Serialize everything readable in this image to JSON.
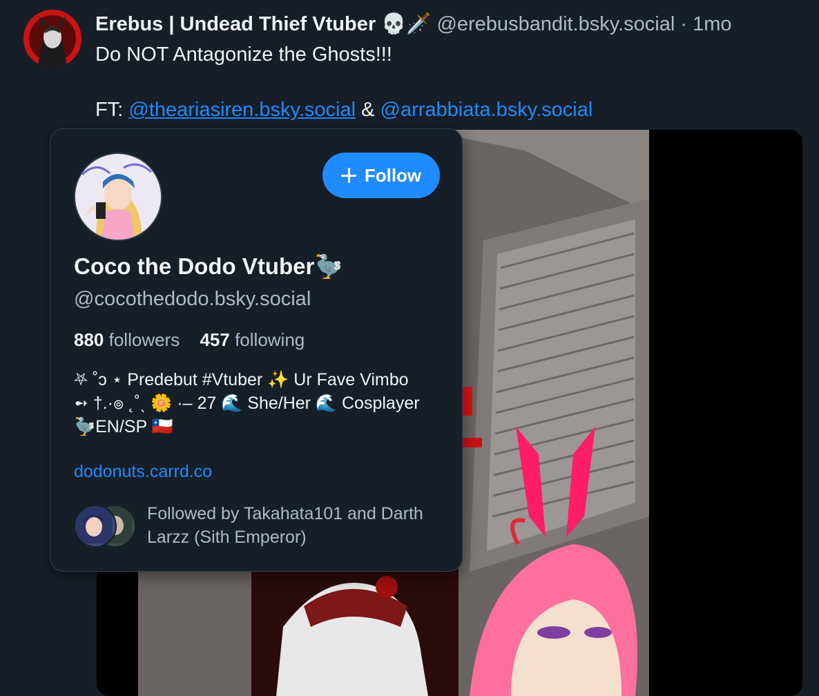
{
  "post": {
    "author_name": "Erebus | Undead Thief Vtuber 💀🗡️",
    "author_handle": "@erebusbandit.bsky.social",
    "separator": "·",
    "time": "1mo",
    "text_line1": "Do NOT Antagonize the Ghosts!!!",
    "ft_label": "FT:",
    "mention1": "@theariasiren.bsky.social",
    "conjunction": "&",
    "mention2": "@arrabbiata.bsky.social"
  },
  "profile_card": {
    "follow_label": "Follow",
    "display_name": "Coco the Dodo Vtuber🦤",
    "handle": "@cocothedodo.bsky.social",
    "followers_count": "880",
    "followers_label": "followers",
    "following_count": "457",
    "following_label": "following",
    "bio": "⛧ ˚ↄ ⋆ Predebut #Vtuber ✨ Ur Fave Vimbo\n➻ †.·๏ ˛˚ˎ 🌼 ·– 27 🌊 She/Her 🌊 Cosplayer\n🦤EN/SP 🇨🇱",
    "link": "dodonuts.carrd.co",
    "followed_by": "Followed by Takahata101 and Darth Larzz (Sith Emperor)"
  },
  "colors": {
    "background": "#161e27",
    "accent": "#208bfe",
    "muted_text": "#aebbc9",
    "card_border": "#2e4052"
  }
}
